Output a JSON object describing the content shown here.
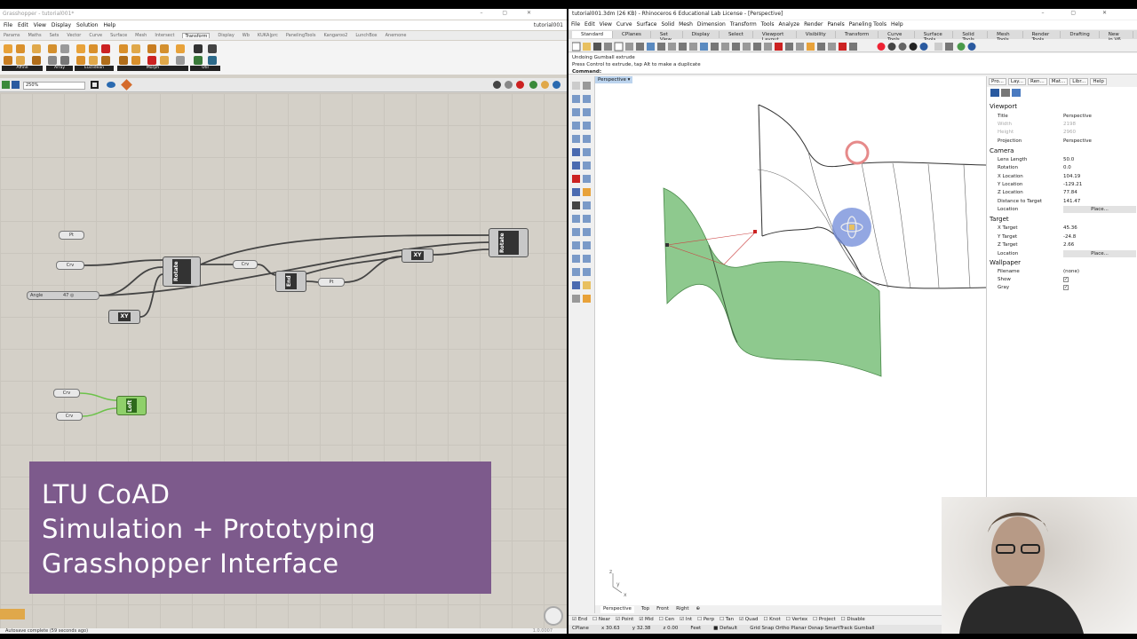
{
  "gh": {
    "title": "Grasshopper - tutorial001*",
    "menu": [
      "File",
      "Edit",
      "View",
      "Display",
      "Solution",
      "Help"
    ],
    "doc_name": "tutorial001",
    "tabs": [
      "Params",
      "Maths",
      "Sets",
      "Vector",
      "Curve",
      "Surface",
      "Mesh",
      "Intersect",
      "Transform",
      "Display",
      "Wb",
      "KUKA|prc",
      "PanelingTools",
      "Kangaroo2",
      "LunchBox",
      "Anemone"
    ],
    "active_tab": "Transform",
    "ribbon_groups": [
      "Affine",
      "Array",
      "Euclidean",
      "Morph",
      "Util"
    ],
    "zoom": "250%",
    "nodes": {
      "pt1": "Pt",
      "crv1": "Crv",
      "angle_label": "Angle",
      "angle_value": "47 ◎",
      "crv2": "Crv",
      "pt2": "Pt",
      "crv3": "Crv",
      "crv4": "Crv"
    },
    "components": {
      "rotate1": "Rotate",
      "xy1": "XY",
      "end": "End",
      "xy2": "XY",
      "rotate2": "Rotate",
      "loft": "Loft"
    },
    "status": "Autosave complete (59 seconds ago)",
    "version": "1.0.0007"
  },
  "banner": {
    "line1": "LTU CoAD",
    "line2": "Simulation + Prototyping",
    "line3": "Grasshopper Interface"
  },
  "rhino": {
    "title": "tutorial001.3dm (26 KB) - Rhinoceros 6 Educational Lab License - [Perspective]",
    "menu": [
      "File",
      "Edit",
      "View",
      "Curve",
      "Surface",
      "Solid",
      "Mesh",
      "Dimension",
      "Transform",
      "Tools",
      "Analyze",
      "Render",
      "Panels",
      "Paneling Tools",
      "Help"
    ],
    "tabs": [
      "Standard",
      "CPlanes",
      "Set View",
      "Display",
      "Select",
      "Viewport Layout",
      "Visibility",
      "Transform",
      "Curve Tools",
      "Surface Tools",
      "Solid Tools",
      "Mesh Tools",
      "Render Tools",
      "Drafting",
      "New in V6"
    ],
    "active_tab": "Standard",
    "cmd_history": [
      "Undoing Gumball extrude",
      "Press Control to extrude, tap Alt to make a duplicate"
    ],
    "cmd_prompt": "Command:",
    "viewport_label": "Perspective ▾",
    "viewport_tabs": [
      "Perspective",
      "Top",
      "Front",
      "Right",
      "⊕"
    ],
    "osnaps": [
      "End",
      "Near",
      "Point",
      "Mid",
      "Cen",
      "Int",
      "Perp",
      "Tan",
      "Quad",
      "Knot",
      "Vertex",
      "Project",
      "Disable"
    ],
    "status": {
      "cplane": "CPlane",
      "x": "x 30.63",
      "y": "y 32.38",
      "z": "z 0.00",
      "units": "Feet",
      "layer": "Default",
      "toggles": "Grid Snap   Ortho   Planar   Osnap   SmartTrack   Gumball"
    },
    "panel": {
      "tabs": [
        "Pro...",
        "Lay...",
        "Ren...",
        "Mat...",
        "Libr...",
        "Help"
      ],
      "viewport_header": "Viewport",
      "title_label": "Title",
      "title_value": "Perspective",
      "width_label": "Width",
      "width_value": "2198",
      "height_label": "Height",
      "height_value": "2960",
      "projection_label": "Projection",
      "projection_value": "Perspective",
      "camera_header": "Camera",
      "lens_label": "Lens Length",
      "lens_value": "50.0",
      "rotation_label": "Rotation",
      "rotation_value": "0.0",
      "xloc_label": "X Location",
      "xloc_value": "104.19",
      "yloc_label": "Y Location",
      "yloc_value": "-129.21",
      "zloc_label": "Z Location",
      "zloc_value": "77.84",
      "dist_label": "Distance to Target",
      "dist_value": "141.47",
      "location_label": "Location",
      "place_btn": "Place...",
      "target_header": "Target",
      "xt_label": "X Target",
      "xt_value": "45.36",
      "yt_label": "Y Target",
      "yt_value": "-24.8",
      "zt_label": "Z Target",
      "zt_value": "2.66",
      "tloc_label": "Location",
      "place_btn2": "Place...",
      "wallpaper_header": "Wallpaper",
      "filename_label": "Filename",
      "filename_value": "(none)",
      "show_label": "Show",
      "gray_label": "Gray"
    }
  }
}
